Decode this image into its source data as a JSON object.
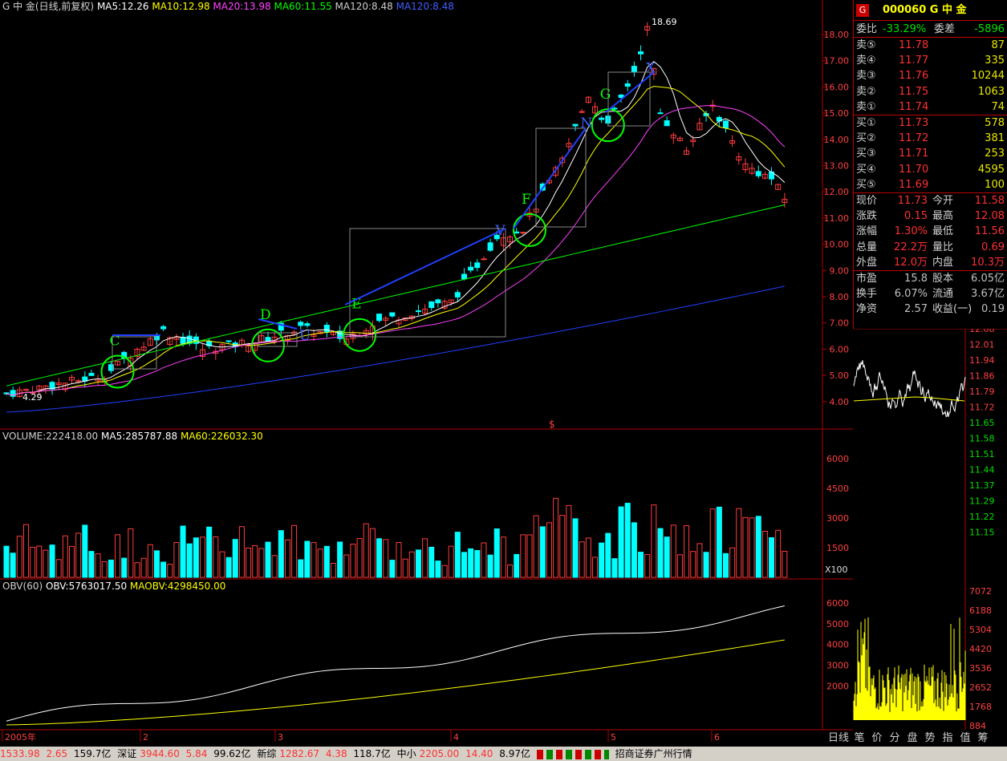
{
  "main": {
    "title_prefix": "G 中  金(日线,前复权)",
    "ma5": "MA5:12.26",
    "ma10": "MA10:12.98",
    "ma20": "MA20:13.98",
    "ma60": "MA60:11.55",
    "ma120": "MA120:8.48",
    "ma120b": "MA120:8.48",
    "high_label": "18.69",
    "low_label": "4.29",
    "marks": [
      "C",
      "D",
      "E",
      "U",
      "F",
      "V",
      "N",
      "G",
      "X"
    ],
    "y_ticks": [
      "18.00",
      "17.00",
      "16.00",
      "15.00",
      "14.00",
      "13.00",
      "12.00",
      "11.00",
      "10.00",
      "9.00",
      "8.00",
      "7.00",
      "6.00",
      "5.00",
      "4.00"
    ],
    "center_mark": "$"
  },
  "volume": {
    "title": "VOLUME:222418.00",
    "ma5": "MA5:285787.88",
    "ma60": "MA60:226032.30",
    "y_ticks": [
      "6000",
      "4500",
      "3000",
      "1500"
    ],
    "unit": "X100"
  },
  "obv": {
    "title": "OBV(60)",
    "obv": "OBV:5763017.50",
    "maobv": "MAOBV:4298450.00",
    "y_ticks": [
      "6000",
      "5000",
      "4000",
      "3000",
      "2000"
    ]
  },
  "x_axis": [
    "2005年",
    "2",
    "3",
    "4",
    "5",
    "6"
  ],
  "quote": {
    "g_badge": "G",
    "code": "000060 G 中  金",
    "weibi_label": "委比",
    "weibi": "-33.29%",
    "weicha_label": "委差",
    "weicha": "-5896",
    "sells": [
      {
        "label": "卖⑤",
        "price": "11.78",
        "vol": "87"
      },
      {
        "label": "卖④",
        "price": "11.77",
        "vol": "335"
      },
      {
        "label": "卖③",
        "price": "11.76",
        "vol": "10244"
      },
      {
        "label": "卖②",
        "price": "11.75",
        "vol": "1063"
      },
      {
        "label": "卖①",
        "price": "11.74",
        "vol": "74"
      }
    ],
    "buys": [
      {
        "label": "买①",
        "price": "11.73",
        "vol": "578"
      },
      {
        "label": "买②",
        "price": "11.72",
        "vol": "381"
      },
      {
        "label": "买③",
        "price": "11.71",
        "vol": "253"
      },
      {
        "label": "买④",
        "price": "11.70",
        "vol": "4595"
      },
      {
        "label": "买⑤",
        "price": "11.69",
        "vol": "100"
      }
    ],
    "stats": [
      {
        "l1": "现价",
        "v1": "11.73",
        "l2": "今开",
        "v2": "11.58"
      },
      {
        "l1": "涨跌",
        "v1": "0.15",
        "l2": "最高",
        "v2": "12.08"
      },
      {
        "l1": "涨幅",
        "v1": "1.30%",
        "l2": "最低",
        "v2": "11.56"
      },
      {
        "l1": "总量",
        "v1": "22.2万",
        "l2": "量比",
        "v2": "0.69"
      },
      {
        "l1": "外盘",
        "v1": "12.0万",
        "l2": "内盘",
        "v2": "10.3万"
      }
    ],
    "fund": [
      {
        "l1": "市盈",
        "v1": "15.8",
        "l2": "股本",
        "v2": "6.05亿"
      },
      {
        "l1": "换手",
        "v1": "6.07%",
        "l2": "流通",
        "v2": "3.67亿"
      },
      {
        "l1": "净资",
        "v1": "2.57",
        "l2": "收益(一)",
        "v2": "0.19"
      }
    ]
  },
  "intraday": {
    "price_ticks": [
      "12.08",
      "12.01",
      "11.94",
      "11.86",
      "11.79",
      "11.72",
      "11.65",
      "11.58",
      "11.51",
      "11.44",
      "11.37",
      "11.29",
      "11.22",
      "11.15"
    ],
    "vol_ticks": [
      "7072",
      "6188",
      "5304",
      "4420",
      "3536",
      "2652",
      "1768",
      "884"
    ]
  },
  "tabs": [
    "日线",
    "笔",
    "价",
    "分",
    "盘",
    "势",
    "指",
    "值",
    "筹"
  ],
  "status": {
    "sh_index": "1533.98",
    "sh_chg": "2.65",
    "sh_amt": "159.7亿",
    "sz_label": "深证",
    "sz_index": "3944.60",
    "sz_chg": "5.84",
    "sz_amt": "99.62亿",
    "xz_label": "新综",
    "xz_index": "1282.67",
    "xz_chg": "4.38",
    "xz_amt": "118.7亿",
    "zx_label": "中小",
    "zx_index": "2205.00",
    "zx_chg": "14.40",
    "zx_amt": "8.97亿",
    "broker": "招商证券广州行情"
  },
  "colors": {
    "up": "#ff3c3c",
    "down": "#00ffff",
    "ma5": "#ffffff",
    "ma10": "#ffff00",
    "ma20": "#ff40ff",
    "ma60": "#00ff00",
    "ma120": "#2040ff",
    "grid": "#b00000",
    "circle": "#00ff00",
    "trend": "#2040ff"
  }
}
